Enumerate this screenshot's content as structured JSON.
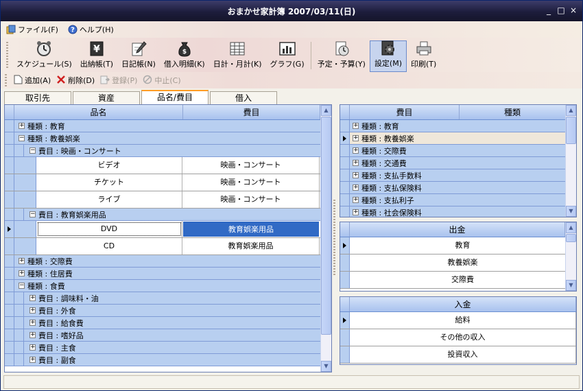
{
  "window": {
    "title": "おまかせ家計簿 2007/03/11(日)",
    "controls": [
      "_",
      "□",
      "×"
    ]
  },
  "menu": [
    {
      "label": "ファイル(F)",
      "icon": "file-icon"
    },
    {
      "label": "ヘルプ(H)",
      "icon": "help-icon"
    }
  ],
  "toolbar": [
    {
      "label": "スケジュール(S)",
      "icon": "alarm-clock-icon",
      "name": "schedule"
    },
    {
      "label": "出納帳(T)",
      "icon": "yen-book-icon",
      "name": "cashbook"
    },
    {
      "label": "日記帳(N)",
      "icon": "pencil-note-icon",
      "name": "diary"
    },
    {
      "label": "借入明細(K)",
      "icon": "money-bag-icon",
      "name": "loan-details"
    },
    {
      "label": "日計・月計(K)",
      "icon": "spreadsheet-icon",
      "name": "daily-monthly"
    },
    {
      "label": "グラフ(G)",
      "icon": "graph-icon",
      "name": "graph"
    },
    {
      "label": "予定・予算(Y)",
      "icon": "budget-icon",
      "name": "budget"
    },
    {
      "label": "設定(M)",
      "icon": "settings-gear-icon",
      "name": "settings",
      "active": true
    },
    {
      "label": "印刷(T)",
      "icon": "printer-icon",
      "name": "print"
    }
  ],
  "subbar": [
    {
      "label": "追加(A)",
      "icon": "add-page-icon",
      "disabled": false
    },
    {
      "label": "削除(D)",
      "icon": "delete-x-icon",
      "disabled": false
    },
    {
      "label": "登録(P)",
      "icon": "register-icon",
      "disabled": true
    },
    {
      "label": "中止(C)",
      "icon": "cancel-circle-icon",
      "disabled": true
    }
  ],
  "tabs": [
    {
      "label": "取引先",
      "active": false
    },
    {
      "label": "資産",
      "active": false
    },
    {
      "label": "品名/費目",
      "active": true
    },
    {
      "label": "借入",
      "active": false
    }
  ],
  "main_grid": {
    "headers": [
      "品名",
      "費目"
    ],
    "rows": [
      {
        "type": "group",
        "level": 0,
        "expanded": false,
        "label": "種類 : 教育"
      },
      {
        "type": "group",
        "level": 0,
        "expanded": true,
        "label": "種類 : 教養娯楽"
      },
      {
        "type": "group",
        "level": 1,
        "expanded": true,
        "label": "費目 : 映画・コンサート"
      },
      {
        "type": "data",
        "cells": [
          "ビデオ",
          "映画・コンサート"
        ]
      },
      {
        "type": "data",
        "cells": [
          "チケット",
          "映画・コンサート"
        ]
      },
      {
        "type": "data",
        "cells": [
          "ライブ",
          "映画・コンサート"
        ]
      },
      {
        "type": "group",
        "level": 1,
        "expanded": true,
        "label": "費目 : 教育娯楽用品"
      },
      {
        "type": "data",
        "cells": [
          "DVD",
          "教育娯楽用品"
        ],
        "current": true
      },
      {
        "type": "data",
        "cells": [
          "CD",
          "教育娯楽用品"
        ]
      },
      {
        "type": "group",
        "level": 0,
        "expanded": false,
        "label": "種類 : 交際費"
      },
      {
        "type": "group",
        "level": 0,
        "expanded": false,
        "label": "種類 : 住居費"
      },
      {
        "type": "group",
        "level": 0,
        "expanded": true,
        "label": "種類 : 食費"
      },
      {
        "type": "group",
        "level": 1,
        "expanded": false,
        "label": "費目 : 調味料・油"
      },
      {
        "type": "group",
        "level": 1,
        "expanded": false,
        "label": "費目 : 外食"
      },
      {
        "type": "group",
        "level": 1,
        "expanded": false,
        "label": "費目 : 給食費"
      },
      {
        "type": "group",
        "level": 1,
        "expanded": false,
        "label": "費目 : 嗜好品"
      },
      {
        "type": "group",
        "level": 1,
        "expanded": false,
        "label": "費目 : 主食"
      },
      {
        "type": "group",
        "level": 1,
        "expanded": false,
        "label": "費目 : 副食"
      }
    ]
  },
  "category_grid": {
    "headers": [
      "費目",
      "種類"
    ],
    "rows": [
      {
        "label": "種類 : 教育"
      },
      {
        "label": "種類 : 教養娯楽",
        "current": true
      },
      {
        "label": "種類 : 交際費"
      },
      {
        "label": "種類 : 交通費"
      },
      {
        "label": "種類 : 支払手数料"
      },
      {
        "label": "種類 : 支払保険料"
      },
      {
        "label": "種類 : 支払利子"
      },
      {
        "label": "種類 : 社会保険料"
      }
    ]
  },
  "expense_grid": {
    "header": "出金",
    "rows": [
      {
        "label": "教育",
        "current": true
      },
      {
        "label": "教養娯楽"
      },
      {
        "label": "交際費"
      }
    ]
  },
  "income_grid": {
    "header": "入金",
    "rows": [
      {
        "label": "給料",
        "current": true
      },
      {
        "label": "その他の収入"
      },
      {
        "label": "投資収入"
      }
    ]
  },
  "colors": {
    "title_bar": "#1d1d3c",
    "row_blue": "#b8cff0",
    "selection": "#316ac5",
    "active_tab": "#ff9c24"
  }
}
